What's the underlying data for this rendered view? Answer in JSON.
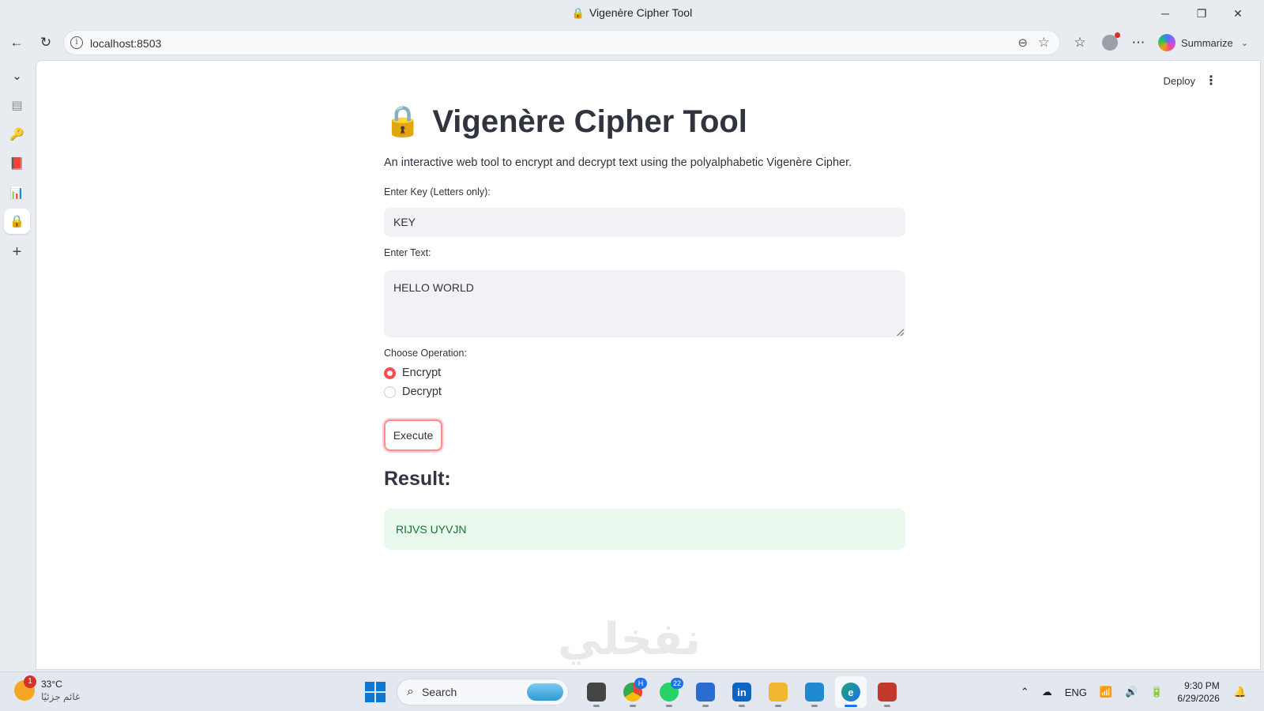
{
  "window": {
    "title": "Vigenère Cipher Tool",
    "title_icon": "🔒",
    "controls": {
      "minimize": "─",
      "restore": "❐",
      "close": "✕"
    }
  },
  "browser": {
    "url": "localhost:8503",
    "summarize_label": "Summarize"
  },
  "sidebar": {
    "items": [
      {
        "name": "collapse",
        "glyph": "⌄"
      },
      {
        "name": "tab-1",
        "glyph": "▤"
      },
      {
        "name": "tab-2",
        "glyph": "🔑"
      },
      {
        "name": "tab-3",
        "glyph": "📕"
      },
      {
        "name": "tab-4",
        "glyph": "📊"
      },
      {
        "name": "tab-5",
        "glyph": "🔒"
      },
      {
        "name": "new-tab",
        "glyph": "+"
      }
    ]
  },
  "app": {
    "deploy_label": "Deploy",
    "title_emoji": "🔒",
    "title": "Vigenère Cipher Tool",
    "description": "An interactive web tool to encrypt and decrypt text using the polyalphabetic Vigenère Cipher.",
    "key_label": "Enter Key (Letters only):",
    "key_value": "KEY",
    "text_label": "Enter Text:",
    "text_value": "HELLO WORLD",
    "operation_label": "Choose Operation:",
    "operations": [
      {
        "label": "Encrypt",
        "selected": true
      },
      {
        "label": "Decrypt",
        "selected": false
      }
    ],
    "execute_label": "Execute",
    "result_heading": "Result:",
    "result_value": "RIJVS UYVJN",
    "accent_color": "#ff4b4b"
  },
  "watermark": "نفخلي",
  "taskbar": {
    "weather_temp": "33°C",
    "weather_desc": "غائم جزئيًا",
    "weather_badge": "1",
    "search_placeholder": "Search",
    "apps": [
      {
        "name": "task-view",
        "label": "",
        "color": "#444",
        "badge": ""
      },
      {
        "name": "chrome",
        "label": "",
        "color": "#34a853",
        "badge": "H"
      },
      {
        "name": "whatsapp",
        "label": "",
        "color": "#25d366",
        "badge": "22"
      },
      {
        "name": "word",
        "label": "",
        "color": "#2b6cd1",
        "badge": ""
      },
      {
        "name": "linkedin",
        "label": "in",
        "color": "#0a66c2",
        "badge": ""
      },
      {
        "name": "file-explorer",
        "label": "",
        "color": "#f2b731",
        "badge": ""
      },
      {
        "name": "vscode",
        "label": "",
        "color": "#1f8ad2",
        "badge": ""
      },
      {
        "name": "edge",
        "label": "e",
        "color": "#1aa1a8",
        "badge": ""
      },
      {
        "name": "snipping-tool",
        "label": "",
        "color": "#c0392b",
        "badge": ""
      }
    ],
    "language": "ENG",
    "time": "9:30 PM",
    "date": "6/29/2026"
  }
}
